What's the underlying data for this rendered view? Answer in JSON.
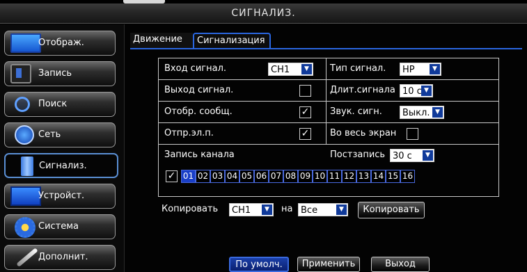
{
  "title": "СИГНАЛИЗ.",
  "sidebar": {
    "items": [
      {
        "label": "Отображ."
      },
      {
        "label": "Запись"
      },
      {
        "label": "Поиск"
      },
      {
        "label": "Сеть"
      },
      {
        "label": "Сигнализ."
      },
      {
        "label": "Устройст."
      },
      {
        "label": "Система"
      },
      {
        "label": "Дополнит."
      }
    ]
  },
  "tabs": [
    "Движение",
    "Сигнализация"
  ],
  "form": {
    "input_label": "Вход сигнал.",
    "input_value": "CH1",
    "type_label": "Тип сигнал.",
    "type_value": "НР",
    "output_label": "Выход сигнал.",
    "duration_label": "Длит.сигнала",
    "duration_value": "10 с",
    "show_msg_label": "Отобр. сообщ.",
    "sound_label": "Звук. сигн.",
    "sound_value": "Выкл.",
    "email_label": "Отпр.эл.п.",
    "fullscreen_label": "Во весь экран",
    "record_channel_label": "Запись канала",
    "post_record_label": "Постзапись",
    "post_record_value": "30 с",
    "channels": [
      "01",
      "02",
      "03",
      "04",
      "05",
      "06",
      "07",
      "08",
      "09",
      "10",
      "11",
      "12",
      "13",
      "14",
      "15",
      "16"
    ]
  },
  "copy": {
    "label": "Копировать",
    "from_value": "CH1",
    "to_label": "на",
    "to_value": "Все",
    "button": "Копировать"
  },
  "buttons": {
    "default": "По умолч.",
    "apply": "Применить",
    "exit": "Выход"
  },
  "checkmark": "✓",
  "arrow": "▼"
}
